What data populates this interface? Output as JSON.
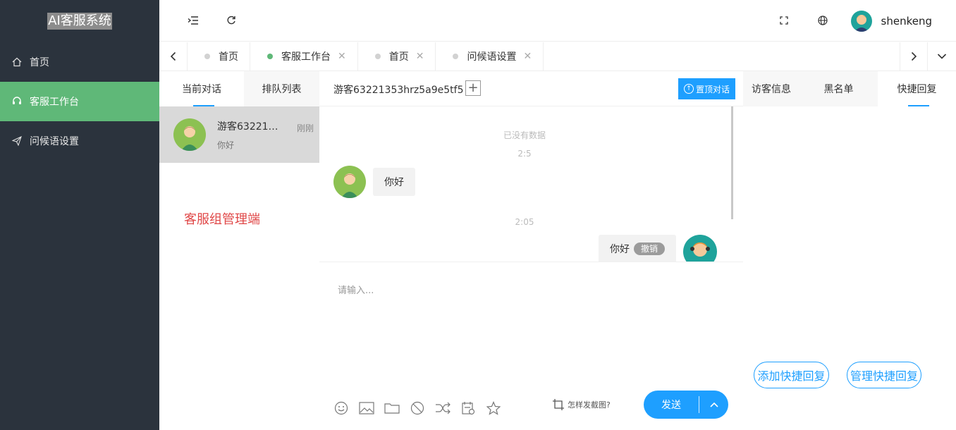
{
  "sidebar": {
    "brand": "AI客服系统",
    "items": [
      {
        "label": "首页",
        "icon": "home-icon"
      },
      {
        "label": "客服工作台",
        "icon": "headset-icon",
        "active": true
      },
      {
        "label": "问候语设置",
        "icon": "send-icon"
      }
    ]
  },
  "header": {
    "username": "shenkeng"
  },
  "tabs": [
    {
      "label": "首页",
      "closable": false
    },
    {
      "label": "客服工作台",
      "closable": true,
      "active": true
    },
    {
      "label": "首页",
      "closable": true
    },
    {
      "label": "问候语设置",
      "closable": true
    }
  ],
  "conversations": {
    "tab_current": "当前对话",
    "tab_queue": "排队列表",
    "items": [
      {
        "name": "游客632213...",
        "last_message": "你好",
        "time": "刚刚"
      }
    ],
    "admin_label": "客服组管理端"
  },
  "chat": {
    "visitor_title": "游客63221353hrz5a9e5tf5",
    "plus": "+",
    "pin_label": "置顶对话",
    "no_data": "已没有数据",
    "messages": [
      {
        "time": "2:5",
        "from": "visitor",
        "text": "你好"
      },
      {
        "time": "2:05",
        "from": "agent",
        "text": "你好",
        "recall_label": "撤销"
      }
    ],
    "input_placeholder": "请输入...",
    "screenshot_hint": "怎样发截图?",
    "send_label": "发送"
  },
  "right_panel": {
    "tabs": [
      "访客信息",
      "黑名单",
      "快捷回复"
    ],
    "active_tab": "快捷回复",
    "add_quick_reply": "添加快捷回复",
    "manage_quick_reply": "管理快捷回复"
  },
  "colors": {
    "sidebar_bg": "#2b333d",
    "active_green": "#5fb878",
    "primary_blue": "#1e9fff",
    "admin_red": "#e04848"
  }
}
